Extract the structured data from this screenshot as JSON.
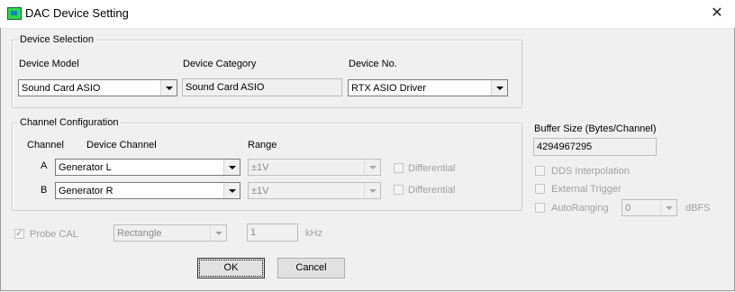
{
  "window": {
    "title": "DAC Device Setting",
    "close_glyph": "✕"
  },
  "device_selection": {
    "title": "Device Selection",
    "model_label": "Device Model",
    "model_value": "Sound Card ASIO",
    "category_label": "Device Category",
    "category_value": "Sound Card ASIO",
    "number_label": "Device No.",
    "number_value": "RTX ASIO Driver"
  },
  "channel_config": {
    "title": "Channel Configuration",
    "col_channel": "Channel",
    "col_device_channel": "Device Channel",
    "col_range": "Range",
    "rows": [
      {
        "channel": "A",
        "device_channel": "Generator L",
        "range": "±1V",
        "differential_label": "Differential",
        "differential_checked": false
      },
      {
        "channel": "B",
        "device_channel": "Generator R",
        "range": "±1V",
        "differential_label": "Differential",
        "differential_checked": false
      }
    ]
  },
  "buffer": {
    "label": "Buffer Size (Bytes/Channel)",
    "value": "4294967295"
  },
  "options": {
    "dds_label": "DDS Interpolation",
    "external_trigger_label": "External Trigger",
    "autoranging_label": "AutoRanging",
    "autoranging_value": "0",
    "autoranging_unit": "dBFS"
  },
  "probe": {
    "label": "Probe CAL",
    "checked": true,
    "waveform": "Rectangle",
    "frequency": "1",
    "unit": "kHz"
  },
  "buttons": {
    "ok": "OK",
    "cancel": "Cancel"
  }
}
